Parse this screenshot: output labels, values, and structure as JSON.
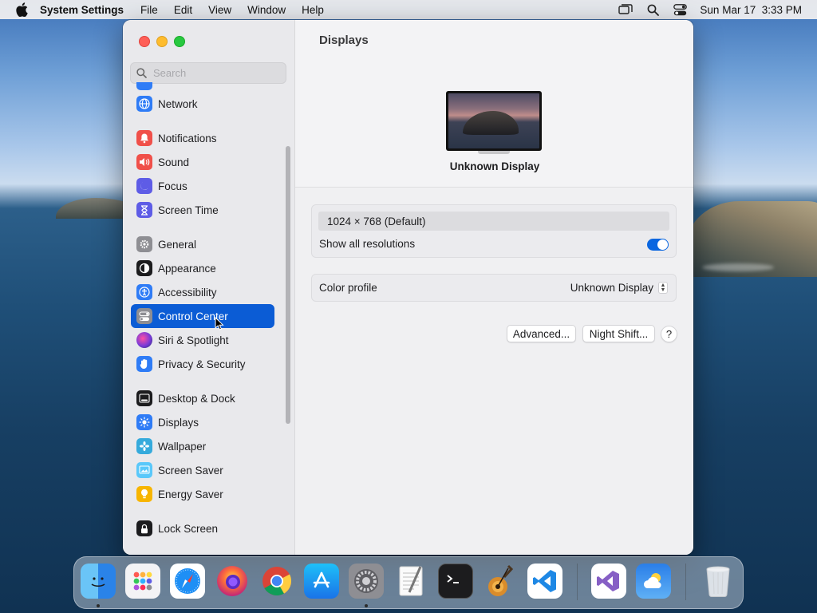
{
  "menubar": {
    "app_name": "System Settings",
    "menus": [
      "File",
      "Edit",
      "View",
      "Window",
      "Help"
    ],
    "clock": "Sun Mar 17  3:33 PM"
  },
  "sidebar": {
    "search_placeholder": "Search",
    "items": [
      {
        "label": "Network",
        "icon": "globe-icon",
        "color": "#2f7cf6"
      },
      {
        "label": "Notifications",
        "icon": "bell-icon",
        "color": "#f0504a"
      },
      {
        "label": "Sound",
        "icon": "speaker-icon",
        "color": "#f0504a"
      },
      {
        "label": "Focus",
        "icon": "moon-icon",
        "color": "#5e5ce6"
      },
      {
        "label": "Screen Time",
        "icon": "hourglass-icon",
        "color": "#5e5ce6"
      },
      {
        "label": "General",
        "icon": "gear-icon",
        "color": "#8e8e93"
      },
      {
        "label": "Appearance",
        "icon": "appearance-icon",
        "color": "#1c1c1e"
      },
      {
        "label": "Accessibility",
        "icon": "accessibility-icon",
        "color": "#2f7cf6"
      },
      {
        "label": "Control Center",
        "icon": "control-center-icon",
        "color": "#8e8e93"
      },
      {
        "label": "Siri & Spotlight",
        "icon": "siri-icon",
        "color": "#7a3ad8"
      },
      {
        "label": "Privacy & Security",
        "icon": "hand-icon",
        "color": "#2f7cf6"
      },
      {
        "label": "Desktop & Dock",
        "icon": "dock-icon",
        "color": "#1c1c1e"
      },
      {
        "label": "Displays",
        "icon": "sun-icon",
        "color": "#2f7cf6"
      },
      {
        "label": "Wallpaper",
        "icon": "wallpaper-icon",
        "color": "#35aadc"
      },
      {
        "label": "Screen Saver",
        "icon": "screensaver-icon",
        "color": "#5ac8fa"
      },
      {
        "label": "Energy Saver",
        "icon": "lightbulb-icon",
        "color": "#f7b500"
      },
      {
        "label": "Lock Screen",
        "icon": "lock-icon",
        "color": "#1c1c1e"
      }
    ],
    "active_item": "Control Center"
  },
  "content": {
    "title": "Displays",
    "display_name": "Unknown Display",
    "resolution": "1024 × 768 (Default)",
    "show_all_resolutions_label": "Show all resolutions",
    "show_all_resolutions_on": true,
    "color_profile_label": "Color profile",
    "color_profile_value": "Unknown Display",
    "advanced_button": "Advanced...",
    "night_shift_button": "Night Shift...",
    "help_button": "?"
  },
  "dock": {
    "apps": [
      "Finder",
      "Launchpad",
      "Safari",
      "Firefox",
      "Chrome",
      "App Store",
      "System Settings",
      "TextEdit",
      "Terminal",
      "GarageBand",
      "Visual Studio Code",
      "Visual Studio",
      "Weather",
      "Trash"
    ]
  },
  "colors": {
    "accent": "#0b5cd5",
    "toggle_on": "#0a66e0"
  }
}
